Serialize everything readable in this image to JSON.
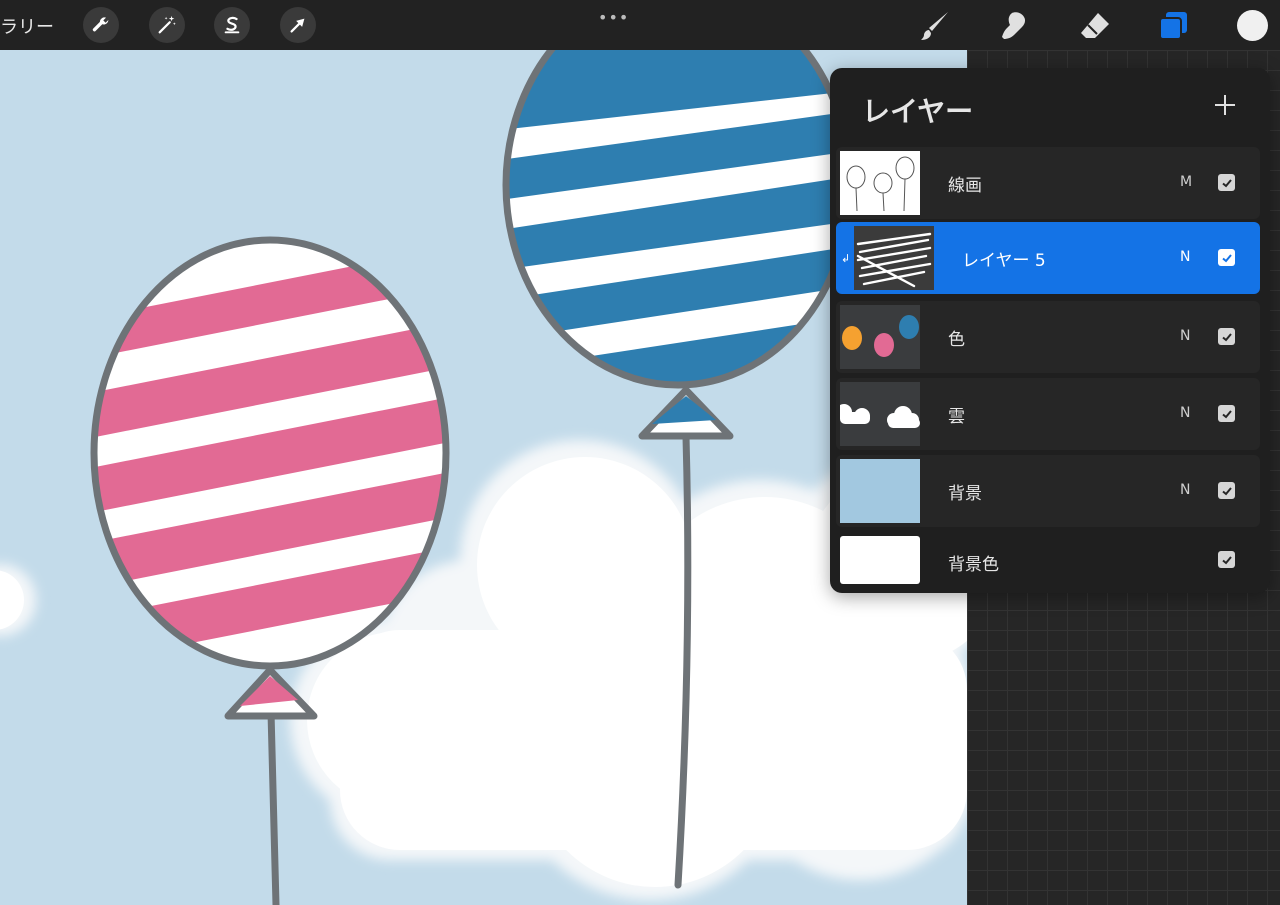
{
  "toolbar": {
    "gallery_label": "ラリー",
    "more": "•••",
    "color_current": "#f0f0f0",
    "tools_left": [
      "wrench-icon",
      "magic-wand-icon",
      "selection-s-icon",
      "transform-arrow-icon"
    ],
    "tools_right": [
      "brush-icon",
      "smudge-icon",
      "eraser-icon",
      "layers-icon"
    ]
  },
  "layers_panel": {
    "title": "レイヤー",
    "add_icon": "plus-icon",
    "layers": [
      {
        "name": "線画",
        "blend": "M",
        "visible": true,
        "active": false,
        "thumb": "line-art-balloons"
      },
      {
        "name": "レイヤー 5",
        "blend": "N",
        "visible": true,
        "active": true,
        "clipped": true,
        "thumb": "white-scribbles"
      },
      {
        "name": "色",
        "blend": "N",
        "visible": true,
        "active": false,
        "thumb": "colored-balloons"
      },
      {
        "name": "雲",
        "blend": "N",
        "visible": true,
        "active": false,
        "thumb": "clouds"
      },
      {
        "name": "背景",
        "blend": "N",
        "visible": true,
        "active": false,
        "thumb": "light-blue-fill"
      },
      {
        "name": "背景色",
        "blend": "",
        "visible": true,
        "active": false,
        "thumb": "white-fill"
      }
    ]
  },
  "colors": {
    "sky": "#c3dbea",
    "pink_balloon": "#e26a94",
    "blue_balloon": "#2e7eb0",
    "outline": "#6e7377",
    "accent": "#1473e6"
  }
}
